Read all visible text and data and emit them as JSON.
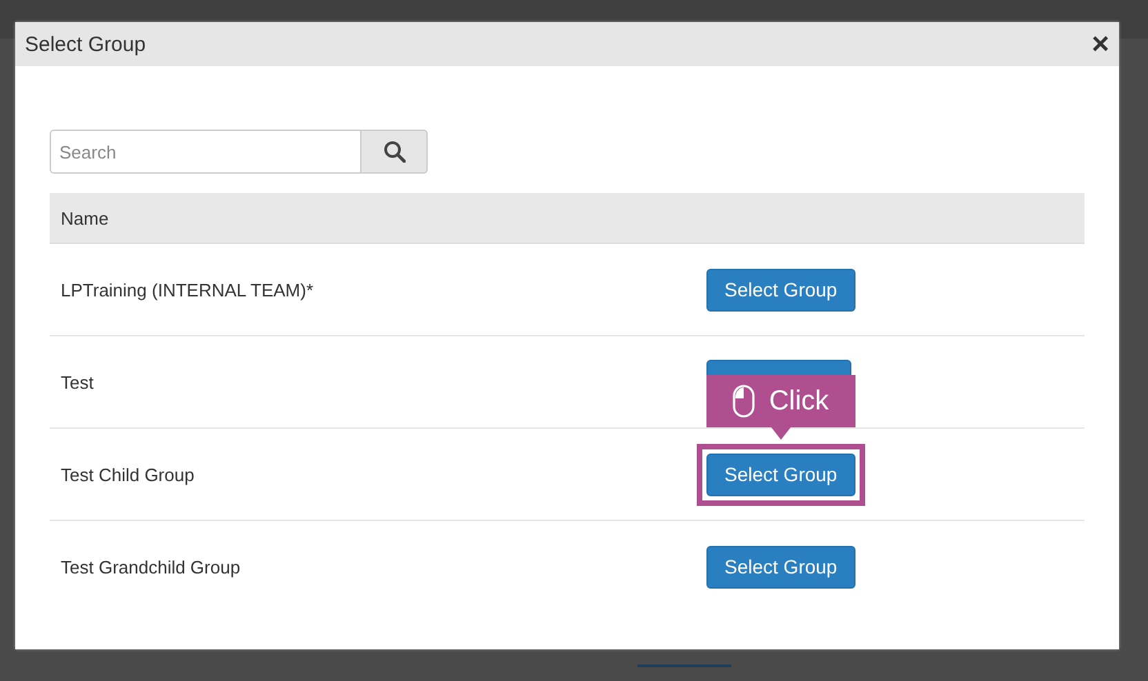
{
  "dialog": {
    "title": "Select Group",
    "close": "×",
    "search": {
      "placeholder": "Search"
    },
    "table": {
      "columns": [
        "Name"
      ],
      "rows": [
        {
          "name": "LPTraining (INTERNAL TEAM)*",
          "action": "Select Group",
          "highlighted": false
        },
        {
          "name": "Test",
          "highlighted": false
        },
        {
          "name": "Test Child Group",
          "action": "Select Group",
          "highlighted": true,
          "callout": "Click"
        },
        {
          "name": "Test Grandchild Group",
          "action": "Select Group",
          "highlighted": false
        }
      ]
    }
  }
}
